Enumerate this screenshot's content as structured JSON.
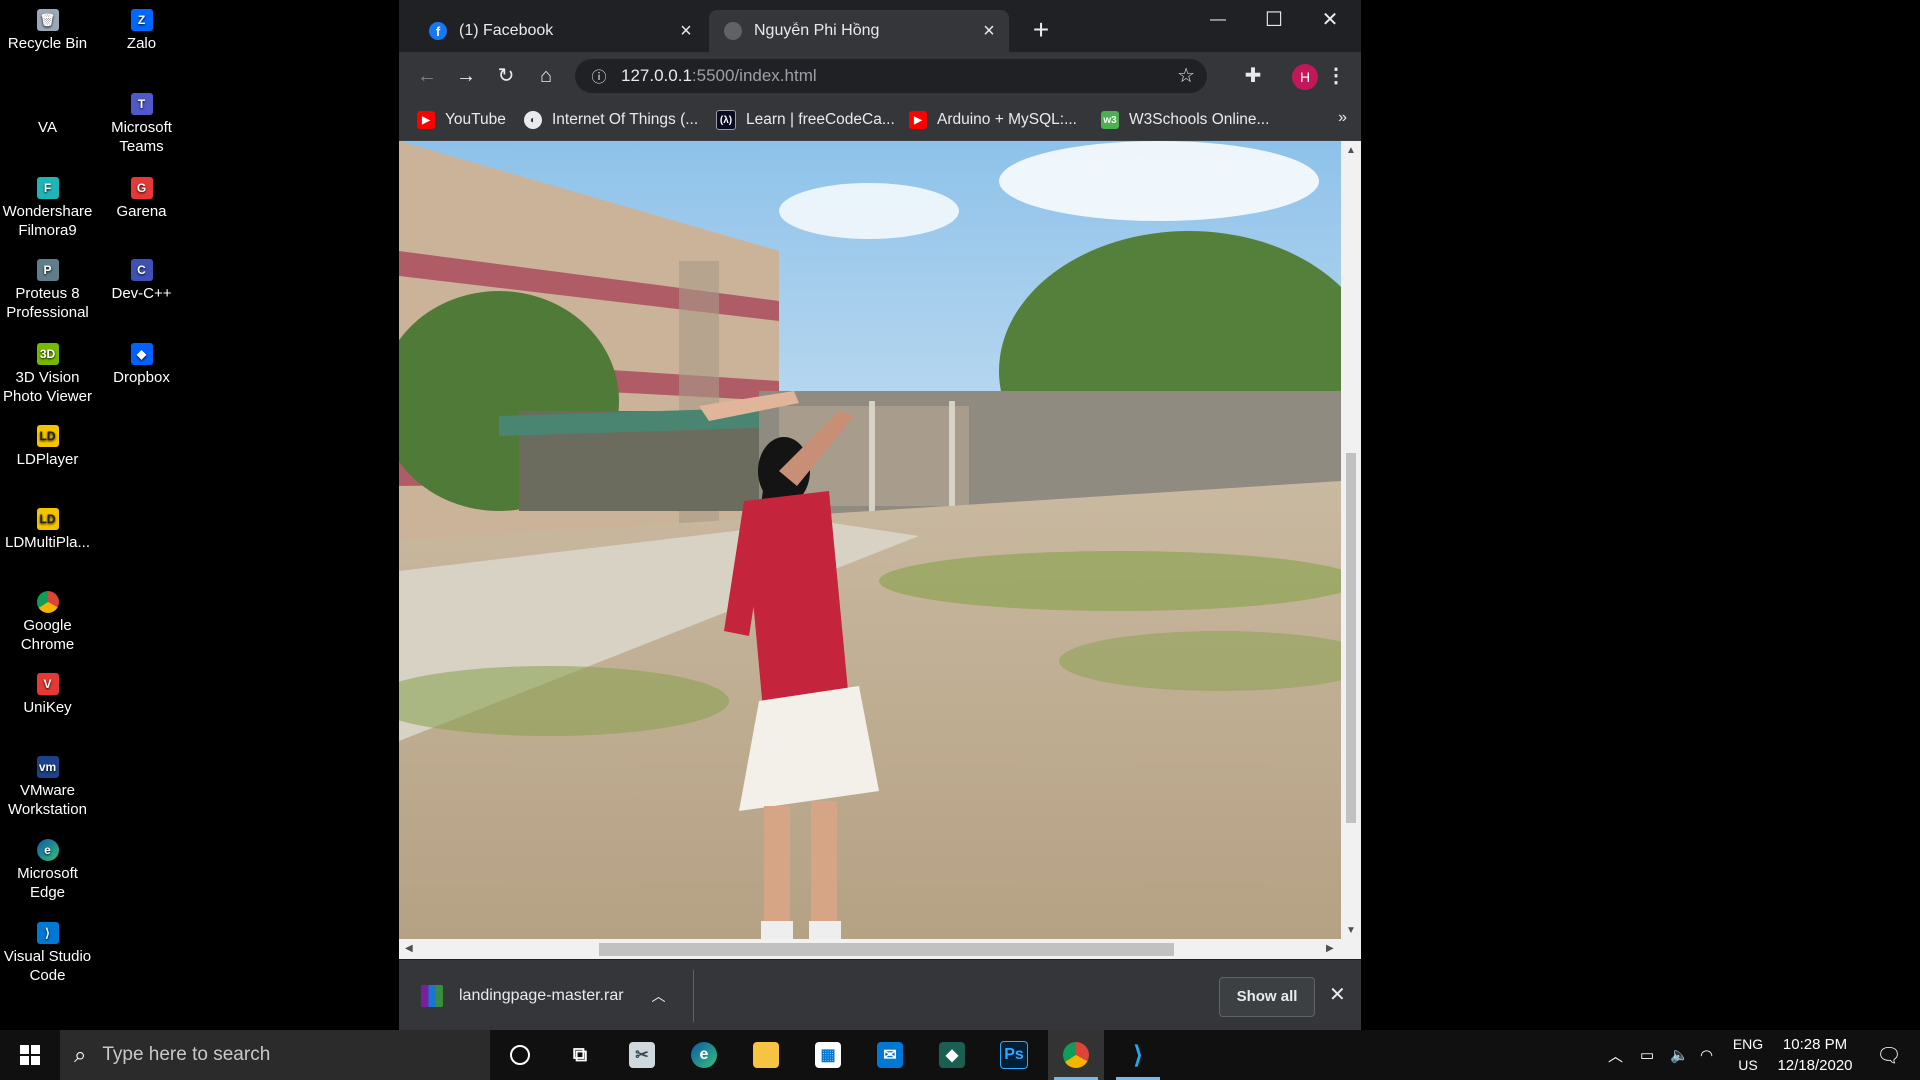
{
  "desktop": {
    "icons": [
      {
        "label": "Recycle Bin"
      },
      {
        "label": "Zalo"
      },
      {
        "label": "VA"
      },
      {
        "label": "Microsoft Teams"
      },
      {
        "label": "Wondershare Filmora9"
      },
      {
        "label": "Garena"
      },
      {
        "label": "Proteus 8 Professional"
      },
      {
        "label": "Dev-C++"
      },
      {
        "label": "3D Vision Photo Viewer"
      },
      {
        "label": "Dropbox"
      },
      {
        "label": "LDPlayer"
      },
      {
        "label": "LDMultiPla..."
      },
      {
        "label": "Google Chrome"
      },
      {
        "label": "UniKey"
      },
      {
        "label": "VMware Workstation"
      },
      {
        "label": "Microsoft Edge"
      },
      {
        "label": "Visual Studio Code"
      }
    ]
  },
  "browser": {
    "tabs": [
      {
        "title": "(1) Facebook",
        "icon": "facebook-icon"
      },
      {
        "title": "Nguyễn Phi Hồng",
        "icon": "globe-icon"
      }
    ],
    "new_tab": "+",
    "window_controls": {
      "minimize": "—",
      "maximize": "☐",
      "close": "✕"
    },
    "address": {
      "host": "127.0.0.1",
      "path": ":5500/index.html"
    },
    "profile_initial": "H",
    "bookmarks": [
      {
        "label": "YouTube",
        "icon": "youtube-icon"
      },
      {
        "label": "Internet Of Things (...",
        "icon": "globe-icon"
      },
      {
        "label": "Learn | freeCodeCa...",
        "icon": "freecodecamp-icon"
      },
      {
        "label": "Arduino + MySQL:...",
        "icon": "youtube-icon"
      },
      {
        "label": "W3Schools Online...",
        "icon": "w3schools-icon"
      }
    ],
    "bookmarks_more": "»"
  },
  "download_shelf": {
    "file_name": "landingpage-master.rar",
    "show_all_label": "Show all",
    "close": "✕"
  },
  "taskbar": {
    "search_placeholder": "Type here to search",
    "pinned": [
      "cortana-icon",
      "task-view-icon",
      "snipping-tool-icon",
      "edge-icon",
      "file-explorer-icon",
      "store-icon",
      "mail-icon",
      "sourcetree-icon",
      "photoshop-icon",
      "chrome-icon",
      "vscode-icon"
    ],
    "language_line1": "ENG",
    "language_line2": "US",
    "time": "10:28 PM",
    "date": "12/18/2020"
  },
  "colors": {
    "chrome_dark": "#202124",
    "chrome_toolbar": "#35363a",
    "profile": "#c2185b"
  }
}
